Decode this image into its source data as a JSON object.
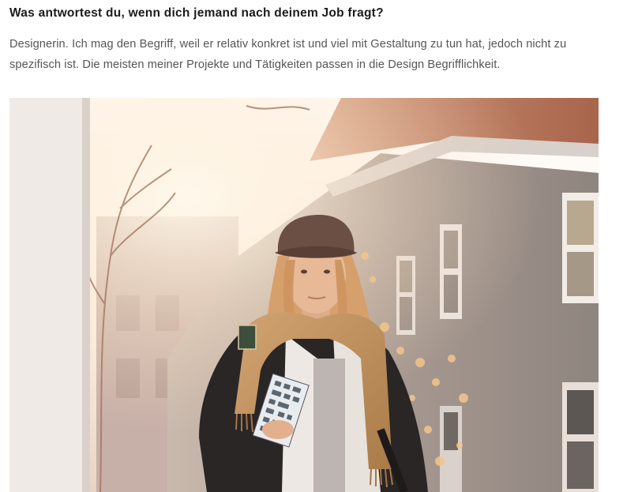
{
  "article": {
    "question": "Was antwortest du, wenn dich jemand nach deinem Job fragt?",
    "answer": "Designerin. Ich mag den Begriff, weil er relativ konkret ist und viel mit Gestaltung zu tun hat, jedoch nicht zu spezifisch ist. Die meisten meiner Projekte und Tätigkeiten passen in die Design Begrifflichkeit."
  },
  "photo": {
    "subject": "portrait-woman-with-cap-scarf-and-book",
    "colors": {
      "sky": "#fbf3e6",
      "building": "#a89a92",
      "wall": "#f0ebe6",
      "scarf": "#c0935e",
      "jacket": "#2a2626",
      "cap": "#6b4e44",
      "hair": "#d6a06c",
      "skin": "#e7b996"
    }
  }
}
